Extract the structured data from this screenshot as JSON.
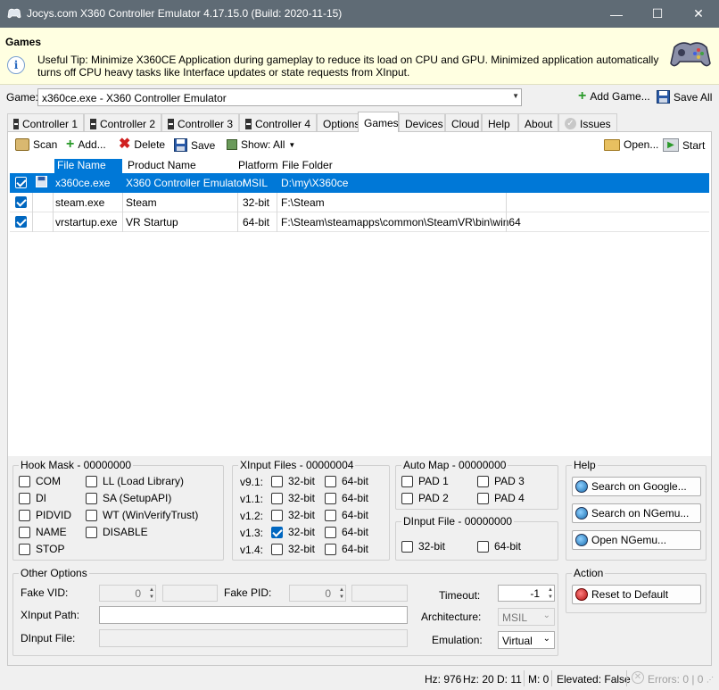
{
  "window": {
    "title": "Jocys.com X360 Controller Emulator 4.17.15.0 (Build: 2020-11-15)",
    "minimize": "—",
    "maximize": "☐",
    "close": "✕"
  },
  "tip": {
    "heading": "Games",
    "text": "Useful Tip: Minimize X360CE Application during gameplay to reduce its load on CPU and GPU. Minimized application automatically turns off CPU heavy tasks like Interface updates or state requests from XInput."
  },
  "game_row": {
    "label": "Game:",
    "selected": "x360ce.exe - X360 Controller Emulator",
    "add_game": "Add Game...",
    "save_all": "Save All"
  },
  "tabs": [
    {
      "label": "Controller 1"
    },
    {
      "label": "Controller 2"
    },
    {
      "label": "Controller 3"
    },
    {
      "label": "Controller 4"
    },
    {
      "label": "Options"
    },
    {
      "label": "Games"
    },
    {
      "label": "Devices"
    },
    {
      "label": "Cloud"
    },
    {
      "label": "Help"
    },
    {
      "label": "About"
    },
    {
      "label": "Issues"
    }
  ],
  "toolbar": {
    "scan": "Scan",
    "add": "Add...",
    "delete": "Delete",
    "save": "Save",
    "show": "Show: All",
    "open": "Open...",
    "start": "Start"
  },
  "grid": {
    "columns": [
      "File Name",
      "Product Name",
      "Platform",
      "File Folder"
    ],
    "rows": [
      {
        "checked": true,
        "file": "x360ce.exe",
        "product": "X360 Controller Emulator",
        "platform": "MSIL",
        "folder": "D:\\my\\X360ce",
        "selected": true
      },
      {
        "checked": true,
        "file": "steam.exe",
        "product": "Steam",
        "platform": "32-bit",
        "folder": "F:\\Steam",
        "selected": false
      },
      {
        "checked": true,
        "file": "vrstartup.exe",
        "product": "VR Startup",
        "platform": "64-bit",
        "folder": "F:\\Steam\\steamapps\\common\\SteamVR\\bin\\win64",
        "selected": false
      }
    ]
  },
  "hook_mask": {
    "title": "Hook Mask - 00000000",
    "left": [
      {
        "label": "COM",
        "checked": false
      },
      {
        "label": "DI",
        "checked": false
      },
      {
        "label": "PIDVID",
        "checked": false
      },
      {
        "label": "NAME",
        "checked": false
      },
      {
        "label": "STOP",
        "checked": false
      }
    ],
    "right": [
      {
        "label": "LL (Load Library)",
        "checked": false
      },
      {
        "label": "SA (SetupAPI)",
        "checked": false
      },
      {
        "label": "WT (WinVerifyTrust)",
        "checked": false
      },
      {
        "label": "DISABLE",
        "checked": false
      }
    ]
  },
  "xinput_files": {
    "title": "XInput Files - 00000004",
    "rows": [
      {
        "version": "v9.1:",
        "b32": false,
        "b64": false
      },
      {
        "version": "v1.1:",
        "b32": false,
        "b64": false
      },
      {
        "version": "v1.2:",
        "b32": false,
        "b64": false
      },
      {
        "version": "v1.3:",
        "b32": true,
        "b64": false
      },
      {
        "version": "v1.4:",
        "b32": false,
        "b64": false
      }
    ],
    "label32": "32-bit",
    "label64": "64-bit"
  },
  "auto_map": {
    "title": "Auto Map - 00000000",
    "pads": [
      "PAD 1",
      "PAD 3",
      "PAD 2",
      "PAD 4"
    ]
  },
  "dinput_file": {
    "title": "DInput File - 00000000",
    "label32": "32-bit",
    "label64": "64-bit"
  },
  "help_group": {
    "title": "Help",
    "google": "Search on Google...",
    "ngemu": "Search on NGemu...",
    "open_ngemu": "Open NGemu..."
  },
  "other_options": {
    "title": "Other Options",
    "fake_vid_label": "Fake VID:",
    "fake_vid": "0",
    "fake_pid_label": "Fake PID:",
    "fake_pid": "0",
    "timeout_label": "Timeout:",
    "timeout": "-1",
    "xinput_path_label": "XInput Path:",
    "xinput_path": "",
    "architecture_label": "Architecture:",
    "architecture": "MSIL",
    "dinput_file_label": "DInput File:",
    "dinput_file": "",
    "emulation_label": "Emulation:",
    "emulation": "Virtual"
  },
  "action": {
    "title": "Action",
    "reset": "Reset to Default"
  },
  "status": {
    "hz": "Hz: 976",
    "hz2": "Hz: 20",
    "d": "D: 11",
    "m": "M: 0",
    "elevated": "Elevated: False",
    "errors": "Errors: 0 | 0"
  }
}
